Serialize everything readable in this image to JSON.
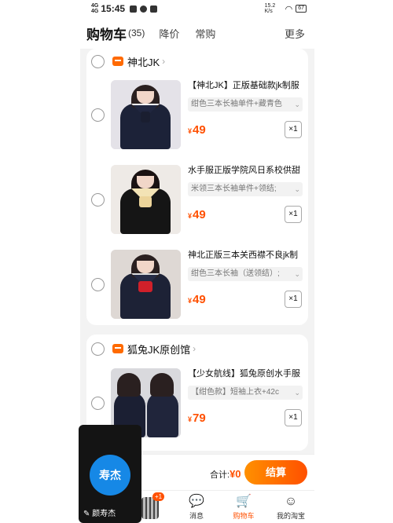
{
  "status_bar": {
    "signal_top": "4G",
    "signal_bottom": "4G",
    "time": "15:45",
    "net_speed": "15.2 K/s",
    "battery": "67"
  },
  "header": {
    "title": "购物车",
    "count": "(35)",
    "tab_price_drop": "降价",
    "tab_frequent": "常购",
    "more": "更多"
  },
  "shops": [
    {
      "name": "神北JK",
      "items": [
        {
          "title": "【神北JK】正版基础款jk制服",
          "sku": "绀色三本长袖单件+藏青色",
          "price": "49",
          "qty": "×1"
        },
        {
          "title": "水手服正版学院风日系校供甜",
          "sku": "米领三本长袖单件+领结;",
          "price": "49",
          "qty": "×1"
        },
        {
          "title": "神北正版三本关西襟不良jk制",
          "sku": "绀色三本长袖（送领结）;",
          "price": "49",
          "qty": "×1"
        }
      ]
    },
    {
      "name": "狐兔JK原创馆",
      "items": [
        {
          "title": "【少女航线】狐兔原创水手服",
          "sku": "【绀色款】短袖上衣+42c",
          "price": "79",
          "qty": "×1"
        }
      ]
    }
  ],
  "checkout": {
    "total_label": "合计:",
    "total_yen": "¥",
    "total_value": "0",
    "settle_label": "结算"
  },
  "tabbar": {
    "badge": "+1",
    "messages": "消息",
    "cart": "购物车",
    "my_taobao": "我的淘宝"
  },
  "floating_video": {
    "avatar_text": "寿杰",
    "caption": "颜寿杰"
  },
  "colors": {
    "accent": "#ff5000",
    "video_circle": "#1688e6"
  }
}
